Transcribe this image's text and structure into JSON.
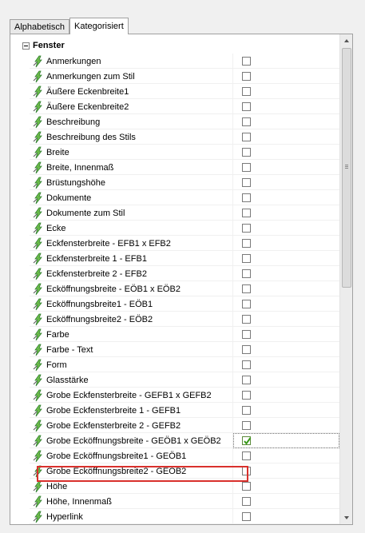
{
  "tabs": [
    {
      "label": "Alphabetisch",
      "active": false
    },
    {
      "label": "Kategorisiert",
      "active": true
    }
  ],
  "category": {
    "label": "Fenster",
    "expanded": true
  },
  "properties": [
    {
      "name": "Anmerkungen",
      "checked": false
    },
    {
      "name": "Anmerkungen zum Stil",
      "checked": false
    },
    {
      "name": "Äußere Eckenbreite1",
      "checked": false
    },
    {
      "name": "Äußere Eckenbreite2",
      "checked": false
    },
    {
      "name": "Beschreibung",
      "checked": false
    },
    {
      "name": "Beschreibung des Stils",
      "checked": false
    },
    {
      "name": "Breite",
      "checked": false
    },
    {
      "name": "Breite, Innenmaß",
      "checked": false
    },
    {
      "name": "Brüstungshöhe",
      "checked": false
    },
    {
      "name": "Dokumente",
      "checked": false
    },
    {
      "name": "Dokumente zum Stil",
      "checked": false
    },
    {
      "name": "Ecke",
      "checked": false
    },
    {
      "name": "Eckfensterbreite - EFB1 x EFB2",
      "checked": false
    },
    {
      "name": "Eckfensterbreite 1 - EFB1",
      "checked": false
    },
    {
      "name": "Eckfensterbreite 2 - EFB2",
      "checked": false
    },
    {
      "name": "Eckö̈ffnungsbreite - EÖB1 x EÖB2",
      "checked": false
    },
    {
      "name": "Ecköffnungsbreite1 - EÖB1",
      "checked": false
    },
    {
      "name": "Ecköffnungsbreite2 - EÖB2",
      "checked": false
    },
    {
      "name": "Farbe",
      "checked": false
    },
    {
      "name": "Farbe - Text",
      "checked": false
    },
    {
      "name": "Form",
      "checked": false
    },
    {
      "name": "Glasstärke",
      "checked": false
    },
    {
      "name": "Grobe Eckfensterbreite - GEFB1 x GEFB2",
      "checked": false
    },
    {
      "name": "Grobe Eckfensterbreite 1 - GEFB1",
      "checked": false
    },
    {
      "name": "Grobe Eckfensterbreite 2 - GEFB2",
      "checked": false
    },
    {
      "name": "Grobe Ecköffnungsbreite - GEÖB1 x GEÖB2",
      "checked": true,
      "selected": true
    },
    {
      "name": "Grobe Ecköffnungsbreite1 - GEÖB1",
      "checked": false
    },
    {
      "name": "Grobe Ecköffnungsbreite2 - GEÖB2",
      "checked": false
    },
    {
      "name": "Höhe",
      "checked": false
    },
    {
      "name": "Höhe, Innenmaß",
      "checked": false
    },
    {
      "name": "Hyperlink",
      "checked": false
    }
  ],
  "colors": {
    "highlight": "#d9302c",
    "check": "#3a9a1a",
    "icon": "#2f7d2f"
  },
  "icon_name": "property-lightning-icon"
}
